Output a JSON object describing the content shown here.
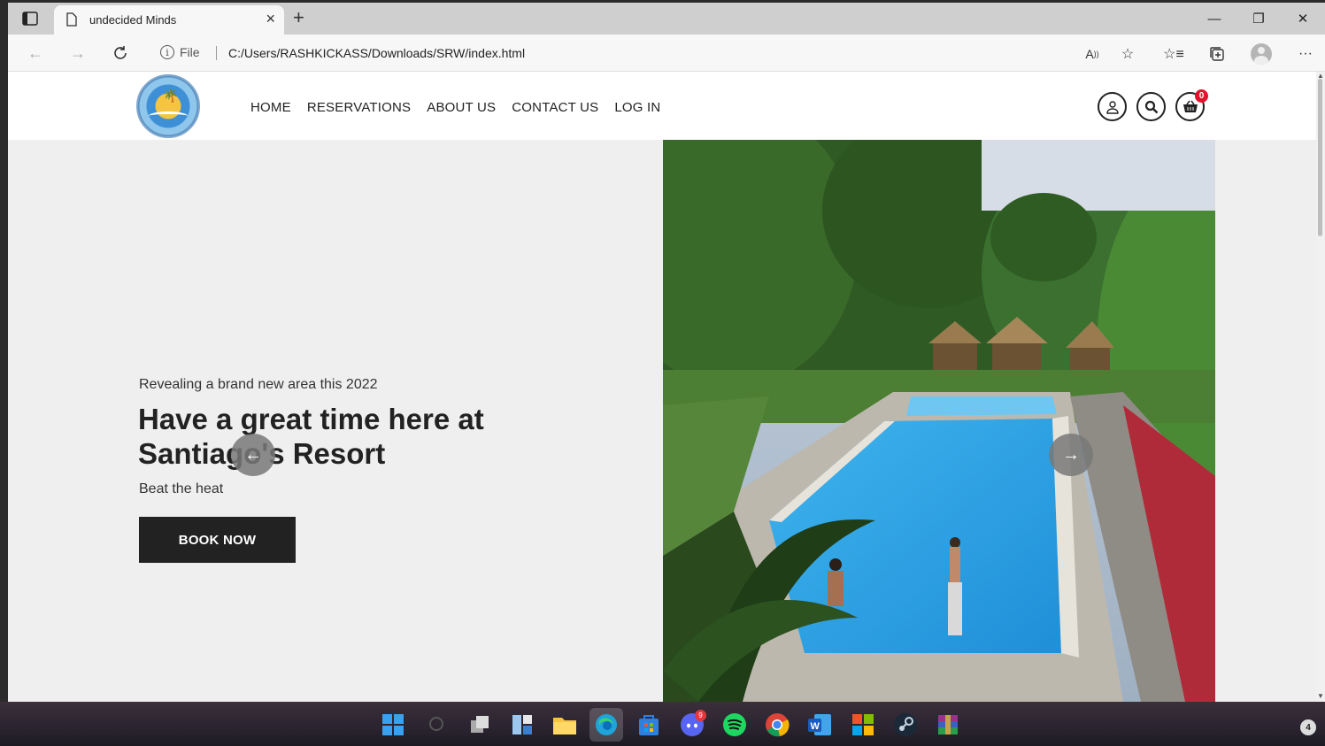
{
  "browser": {
    "tab_title": "undecided Minds",
    "new_tab": "+",
    "url_scheme_label": "File",
    "url": "C:/Users/RASHKICKASS/Downloads/SRW/index.html"
  },
  "site": {
    "nav": [
      "HOME",
      "RESERVATIONS",
      "ABOUT US",
      "CONTACT US",
      "LOG IN"
    ],
    "cart_count": "0"
  },
  "hero": {
    "eyebrow": "Revealing a brand new area this 2022",
    "title": "Have a great time here at Santiago's Resort",
    "subtitle": "Beat the heat",
    "cta": "BOOK NOW"
  },
  "taskbar": {
    "apps": [
      "start",
      "search",
      "task-view",
      "widgets",
      "file-explorer",
      "edge",
      "store",
      "discord",
      "spotify",
      "chrome",
      "word",
      "office",
      "steam",
      "winrar"
    ],
    "discord_badge": "9",
    "notification_count": "4"
  },
  "colors": {
    "accent_dark": "#222222",
    "badge_red": "#e0142c",
    "hero_bg": "#efefef"
  }
}
